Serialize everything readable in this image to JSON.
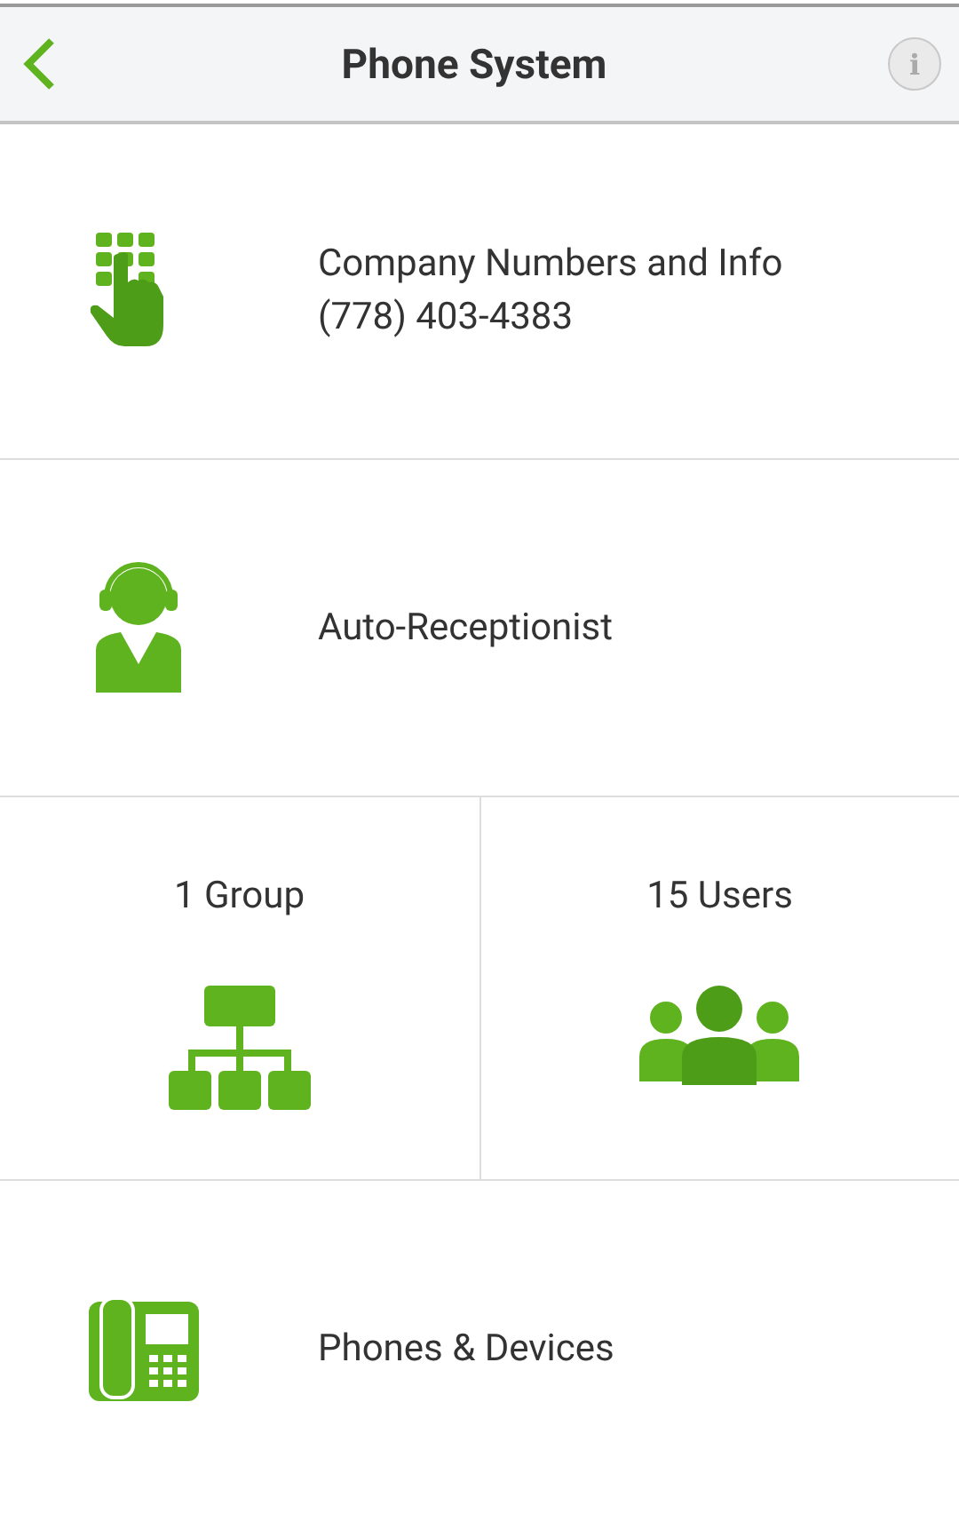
{
  "header": {
    "title": "Phone System",
    "info_glyph": "i"
  },
  "company": {
    "title": "Company Numbers and Info",
    "phone": "(778) 403-4383"
  },
  "receptionist": {
    "title": "Auto-Receptionist"
  },
  "tiles": [
    {
      "label": "1 Group"
    },
    {
      "label": "15 Users"
    }
  ],
  "devices": {
    "title": "Phones & Devices"
  }
}
